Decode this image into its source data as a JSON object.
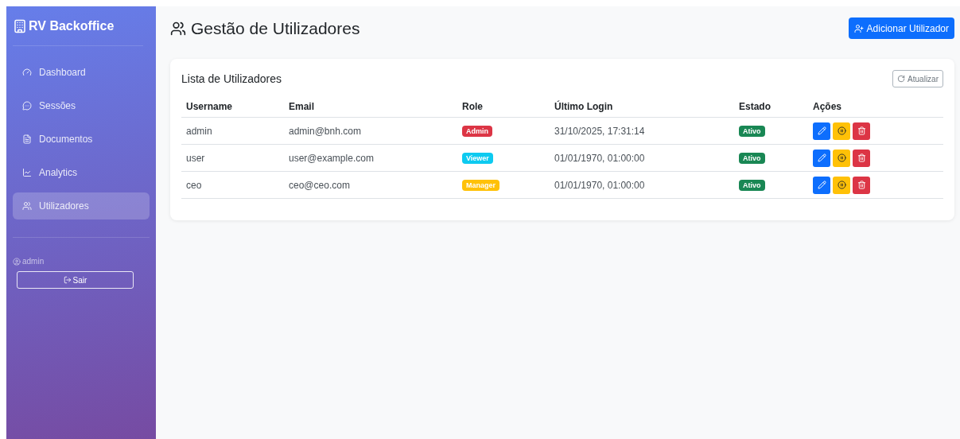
{
  "sidebar": {
    "brand": "RV Backoffice",
    "items": [
      {
        "label": "Dashboard",
        "selected": false
      },
      {
        "label": "Sessões",
        "selected": false
      },
      {
        "label": "Documentos",
        "selected": false
      },
      {
        "label": "Analytics",
        "selected": false
      },
      {
        "label": "Utilizadores",
        "selected": true
      }
    ],
    "user": "admin",
    "logout": "Sair"
  },
  "page": {
    "title": "Gestão de Utilizadores",
    "add_button": "Adicionar Utilizador"
  },
  "card": {
    "title": "Lista de Utilizadores",
    "refresh_button": "Atualizar",
    "table": {
      "columns": [
        "Username",
        "Email",
        "Role",
        "Último Login",
        "Estado",
        "Ações"
      ],
      "rows": [
        {
          "username": "admin",
          "email": "admin@bnh.com",
          "role": {
            "label": "Admin",
            "color": "#dc3545"
          },
          "last_login": "31/10/2025, 17:31:14",
          "status": {
            "label": "Ativo",
            "color": "#198754"
          }
        },
        {
          "username": "user",
          "email": "user@example.com",
          "role": {
            "label": "Viewer",
            "color": "#0dcaf0"
          },
          "last_login": "01/01/1970, 01:00:00",
          "status": {
            "label": "Ativo",
            "color": "#198754"
          }
        },
        {
          "username": "ceo",
          "email": "ceo@ceo.com",
          "role": {
            "label": "Manager",
            "color": "#ffc107"
          },
          "last_login": "01/01/1970, 01:00:00",
          "status": {
            "label": "Ativo",
            "color": "#198754"
          }
        }
      ]
    }
  }
}
